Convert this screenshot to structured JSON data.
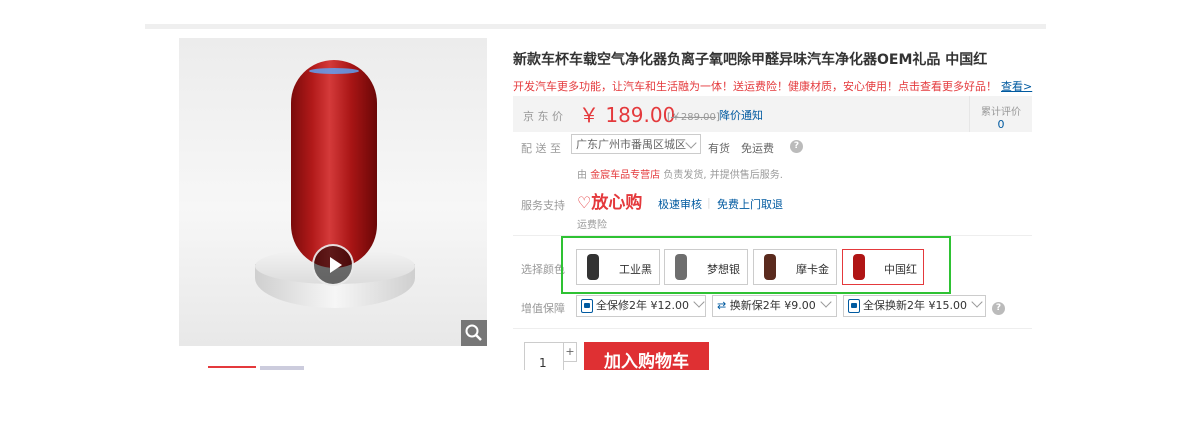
{
  "product": {
    "title": "新款车杯车载空气净化器负离子氧吧除甲醛异味汽车净化器OEM礼品 中国红",
    "promo_text": "开发汽车更多功能，让汽车和生活融为一体！送运费险！健康材质，安心使用！点击查看更多好品！",
    "promo_link": "查看>"
  },
  "price": {
    "label": "京 东 价",
    "current": "￥ 189.00",
    "old_prefix": "[",
    "old": "￥289.00",
    "old_suffix": "]",
    "notify": "降价通知",
    "review_label": "累计评价",
    "review_count": "0"
  },
  "delivery": {
    "label": "配 送 至",
    "address": "广东广州市番禺区城区",
    "stock": "有货",
    "freeship": "免运费",
    "seller_prefix": "由",
    "seller_name": "金宸车品专营店",
    "seller_suffix": "负责发货, 并提供售后服务."
  },
  "service": {
    "label": "服务支持",
    "badge": "放心购",
    "item1": "极速审核",
    "separator": "|",
    "item2": "免费上门取退",
    "item3": "运费险"
  },
  "colors": {
    "label": "选择颜色",
    "options": [
      {
        "name": "工业黑",
        "swatch": "#333333"
      },
      {
        "name": "梦想银",
        "swatch": "#6e6e6e"
      },
      {
        "name": "摩卡金",
        "swatch": "#5a2a1e"
      },
      {
        "name": "中国红",
        "swatch": "#b01515"
      }
    ],
    "selected": "中国红"
  },
  "vas": {
    "label": "增值保障",
    "options": [
      "全保修2年 ¥12.00",
      "换新保2年 ¥9.00",
      "全保换新2年 ¥15.00"
    ]
  },
  "cart": {
    "quantity": "1",
    "plus": "+",
    "add_button": "加入购物车"
  },
  "icons": {
    "play": "play-icon",
    "zoom": "magnifier-icon",
    "help": "question-icon",
    "heart": "heart-icon"
  },
  "colors_theme": {
    "accent_red": "#e4393c",
    "link_blue": "#005aa0",
    "highlight_green": "#2ec233"
  }
}
